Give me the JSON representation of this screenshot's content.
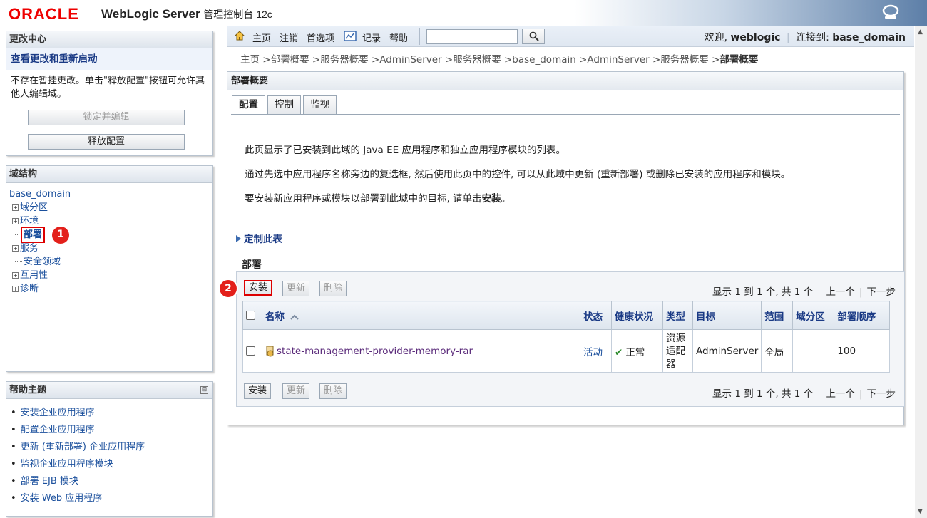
{
  "header": {
    "logo": "ORACLE",
    "product": "WebLogic Server",
    "subtitle": "管理控制台 12c"
  },
  "change_center": {
    "title": "更改中心",
    "subtitle": "查看更改和重新启动",
    "message": "不存在暂挂更改。单击\"释放配置\"按钮可允许其他人编辑域。",
    "lock_button": "锁定并编辑",
    "release_button": "释放配置"
  },
  "domain_structure": {
    "title": "域结构",
    "root": "base_domain",
    "items": [
      {
        "label": "域分区",
        "expandable": true
      },
      {
        "label": "环境",
        "expandable": true
      },
      {
        "label": "部署",
        "expandable": false
      },
      {
        "label": "服务",
        "expandable": true
      },
      {
        "label": "安全领域",
        "expandable": false
      },
      {
        "label": "互用性",
        "expandable": true
      },
      {
        "label": "诊断",
        "expandable": true
      }
    ]
  },
  "badges": {
    "one": "1",
    "two": "2"
  },
  "help": {
    "title": "帮助主题",
    "collapse": "⊟",
    "items": [
      "安装企业应用程序",
      "配置企业应用程序",
      "更新 (重新部署) 企业应用程序",
      "监视企业应用程序模块",
      "部署 EJB 模块",
      "安装 Web 应用程序"
    ]
  },
  "navbar": {
    "home": "主页",
    "logout": "注销",
    "preferences": "首选项",
    "record": "记录",
    "help": "帮助",
    "search_value": "",
    "welcome_prefix": "欢迎, ",
    "user": "weblogic",
    "connected_prefix": "连接到: ",
    "domain": "base_domain"
  },
  "breadcrumb": {
    "path": "主页 >部署概要 >服务器概要 >AdminServer >服务器概要 >base_domain >AdminServer >服务器概要 >",
    "current": "部署概要"
  },
  "main": {
    "title": "部署概要",
    "tabs": [
      "配置",
      "控制",
      "监视"
    ],
    "para1": "此页显示了已安装到此域的 Java EE 应用程序和独立应用程序模块的列表。",
    "para2": "通过先选中应用程序名称旁边的复选框, 然后使用此页中的控件, 可以从此域中更新 (重新部署) 或删除已安装的应用程序和模块。",
    "para3_prefix": "要安装新应用程序或模块以部署到此域中的目标, 请单击",
    "para3_bold": "安装",
    "para3_suffix": "。",
    "customize": "定制此表",
    "deployments_title": "部署",
    "install": "安装",
    "update": "更新",
    "delete": "删除",
    "pager_text": "显示 1 到 1 个, 共 1 个",
    "prev": "上一个",
    "next": "下一步",
    "columns": [
      "名称",
      "状态",
      "健康状况",
      "类型",
      "目标",
      "范围",
      "域分区",
      "部署顺序"
    ],
    "rows": [
      {
        "name": "state-management-provider-memory-rar",
        "state": "活动",
        "health": "正常",
        "type": "资源适配器",
        "target": "AdminServer",
        "scope": "全局",
        "partition": "",
        "order": "100"
      }
    ]
  }
}
